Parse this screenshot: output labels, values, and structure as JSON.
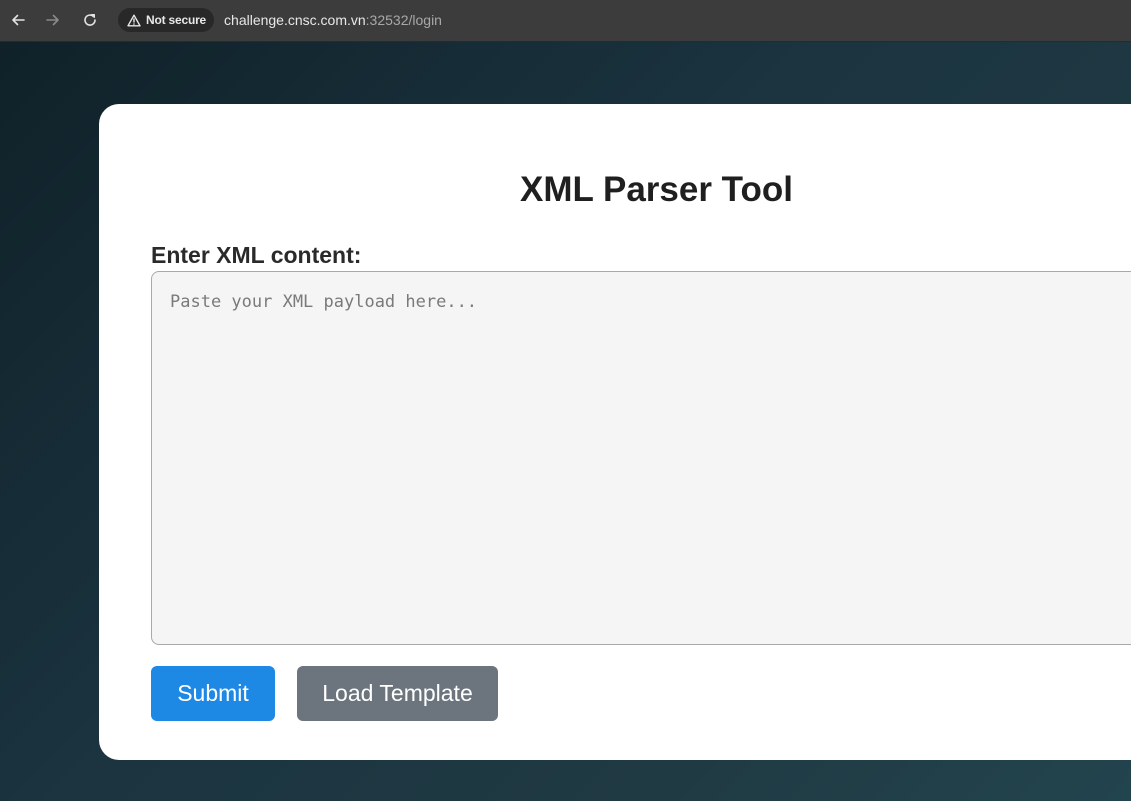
{
  "browser": {
    "security_label": "Not secure",
    "url_host": "challenge.cnsc.com.vn",
    "url_path": ":32532/login",
    "icons": {
      "back": "arrow-left-icon",
      "forward": "arrow-right-icon",
      "reload": "reload-icon",
      "security": "warning-triangle-icon"
    }
  },
  "page": {
    "title": "XML Parser Tool",
    "field_label": "Enter XML content:",
    "textarea": {
      "value": "",
      "placeholder": "Paste your XML payload here..."
    },
    "buttons": {
      "submit": "Submit",
      "load_template": "Load Template"
    },
    "colors": {
      "submit": "#1e88e5",
      "load_template": "#6c757d",
      "card": "#ffffff",
      "background": "#1b3440"
    }
  }
}
